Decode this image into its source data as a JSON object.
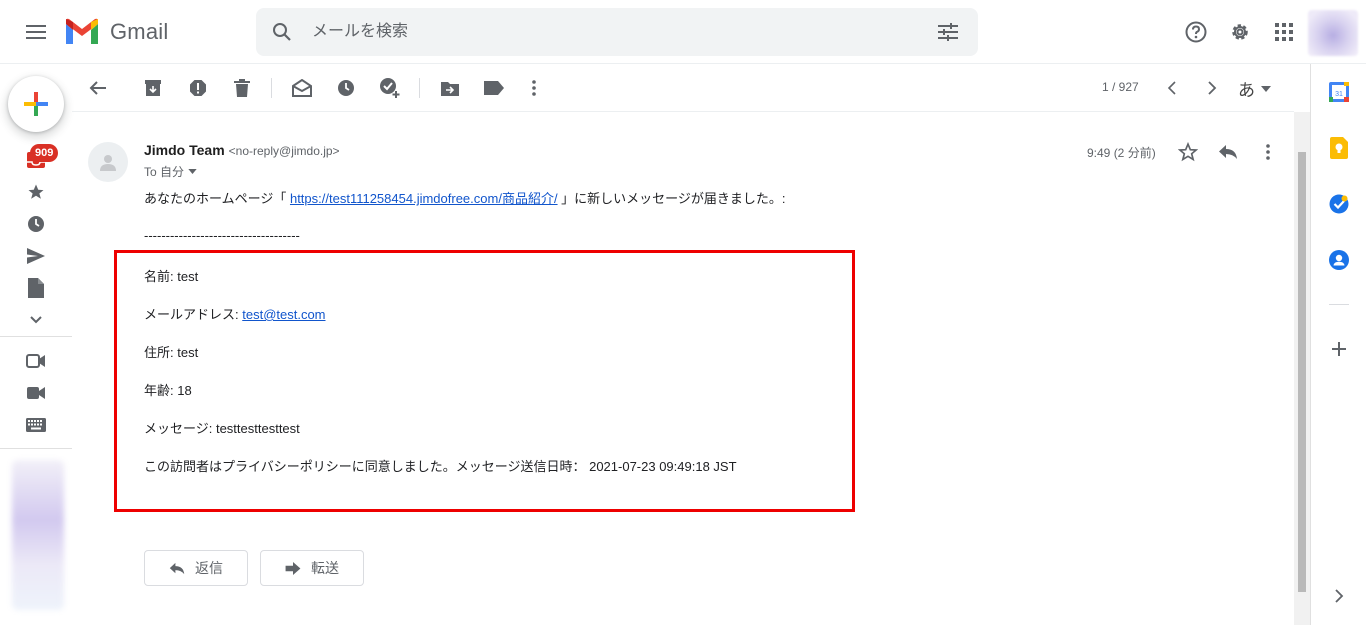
{
  "header": {
    "app_name": "Gmail",
    "search_placeholder": "メールを検索"
  },
  "left_rail": {
    "unread_badge": "909"
  },
  "toolbar": {
    "page_count": "1 / 927",
    "input_tool": "あ"
  },
  "message": {
    "sender_name": "Jimdo Team",
    "sender_email": "<no-reply@jimdo.jp>",
    "to_label": "To 自分",
    "time": "9:49 (2 分前)",
    "intro_before": "あなたのホームページ「 ",
    "intro_link": "https://test111258454.jimdofree.com/商品紹介/",
    "intro_after": " 」に新しいメッセージが届きました。:",
    "divider": "------------------------------------",
    "name_line": "名前: test",
    "email_label": "メールアドレス: ",
    "email_link": "test@test.com",
    "address_line": "住所: test",
    "age_line": "年齢: 18",
    "message_line": "メッセージ: testtesttesttest",
    "privacy_line": "この訪問者はプライバシーポリシーに同意しました。メッセージ送信日時： 2021-07-23 09:49:18 JST"
  },
  "actions": {
    "reply_label": "返信",
    "forward_label": "転送"
  },
  "colors": {
    "highlight_box": "#ee0000",
    "badge": "#d93025",
    "link": "#1155cc"
  }
}
